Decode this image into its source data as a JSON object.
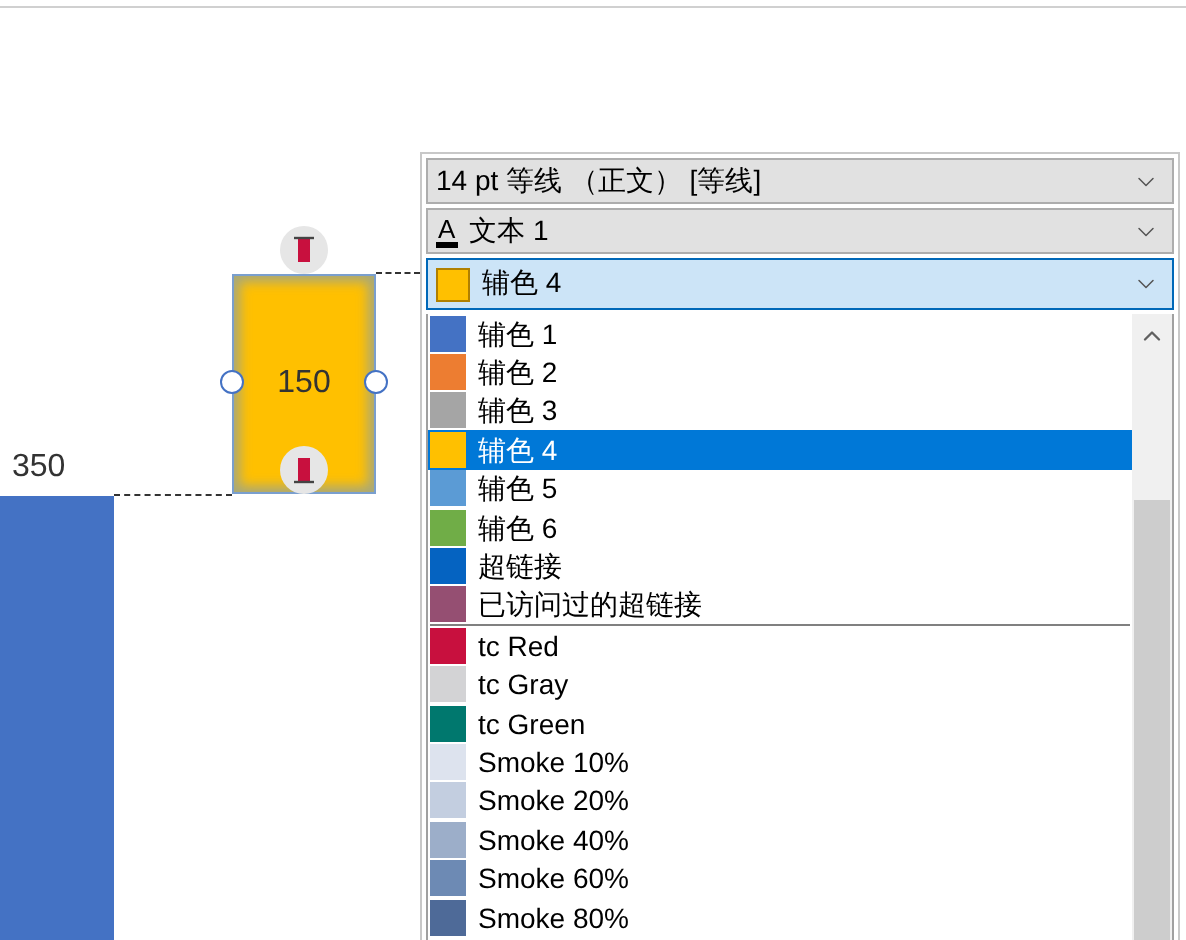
{
  "chart": {
    "bar_label": "350",
    "box_label": "150"
  },
  "font_combo": {
    "value": "14 pt 等线 （正文） [等线]"
  },
  "text_color_combo": {
    "glyph": "A",
    "value": "文本 1"
  },
  "fill_combo": {
    "value": "辅色 4"
  },
  "color_groups": [
    {
      "items": [
        {
          "label": "辅色 1",
          "color": "#4472c4",
          "selected": false
        },
        {
          "label": "辅色 2",
          "color": "#ed7d31",
          "selected": false
        },
        {
          "label": "辅色 3",
          "color": "#a5a5a5",
          "selected": false
        },
        {
          "label": "辅色 4",
          "color": "#ffc000",
          "selected": true
        },
        {
          "label": "辅色 5",
          "color": "#5b9bd5",
          "selected": false
        },
        {
          "label": "辅色 6",
          "color": "#70ad47",
          "selected": false
        },
        {
          "label": "超链接",
          "color": "#0563c1",
          "selected": false
        },
        {
          "label": "已访问过的超链接",
          "color": "#954f72",
          "selected": false
        }
      ]
    },
    {
      "items": [
        {
          "label": "tc Red",
          "color": "#c8103e",
          "selected": false
        },
        {
          "label": "tc Gray",
          "color": "#d3d3d5",
          "selected": false
        },
        {
          "label": "tc Green",
          "color": "#00786e",
          "selected": false
        },
        {
          "label": "Smoke 10%",
          "color": "#dde3ee",
          "selected": false
        },
        {
          "label": "Smoke 20%",
          "color": "#c3cee0",
          "selected": false
        },
        {
          "label": "Smoke 40%",
          "color": "#9caec9",
          "selected": false
        },
        {
          "label": "Smoke 60%",
          "color": "#6d8ab4",
          "selected": false
        },
        {
          "label": "Smoke 80%",
          "color": "#4e6a98",
          "selected": false
        }
      ]
    }
  ]
}
